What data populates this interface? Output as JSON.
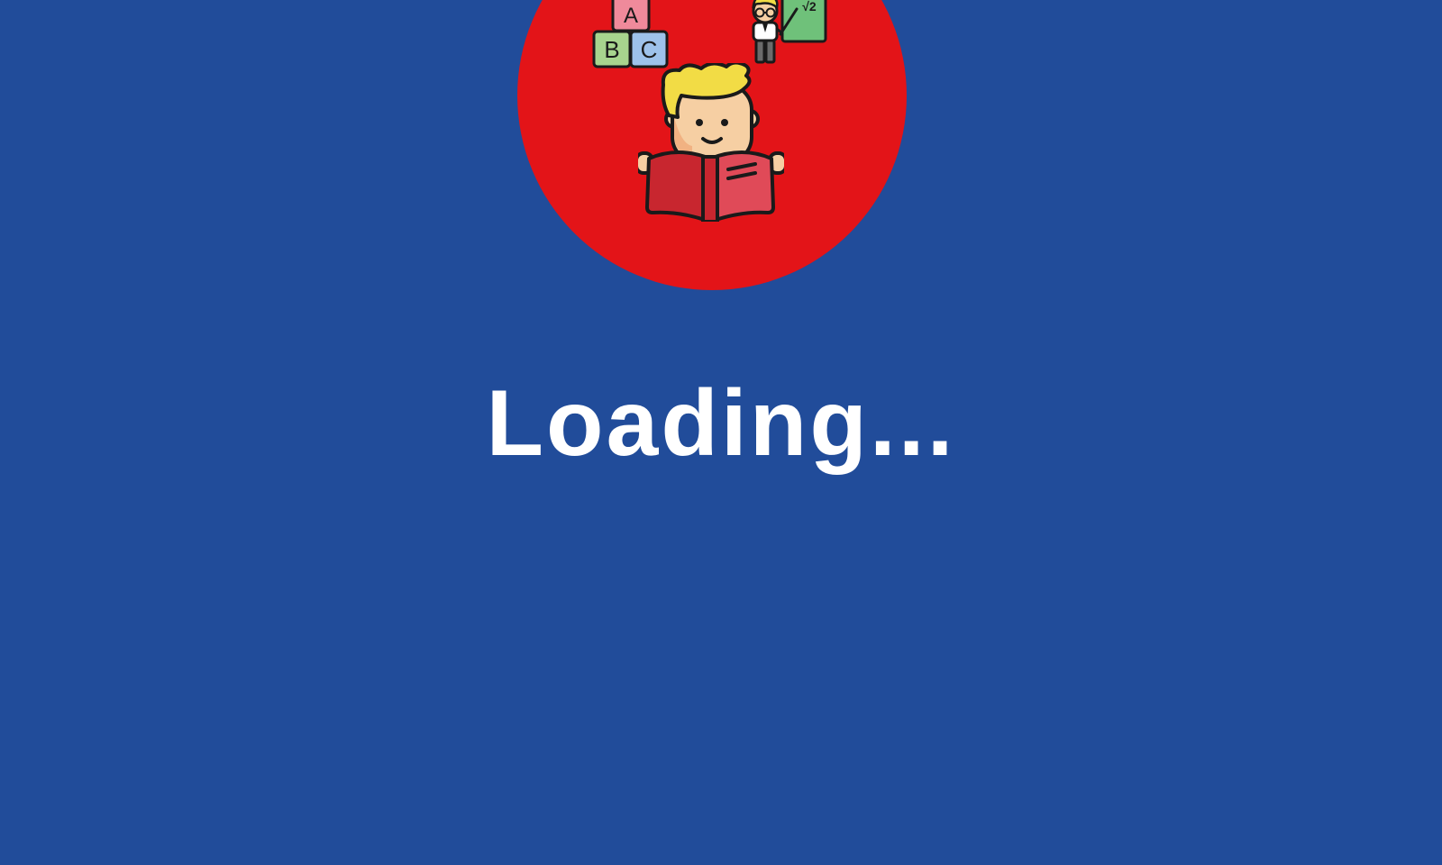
{
  "loading": {
    "text": "Loading..."
  },
  "logo": {
    "blocks": {
      "letter_a": "A",
      "letter_b": "B",
      "letter_c": "C"
    },
    "board_text": "√2"
  },
  "colors": {
    "background": "#214c9a",
    "circle": "#e31418",
    "book": "#c8262f",
    "hair": "#f2dc45",
    "text": "#ffffff"
  },
  "icons": [
    "abc-blocks-icon",
    "teacher-icon",
    "child-reading-book-icon"
  ]
}
